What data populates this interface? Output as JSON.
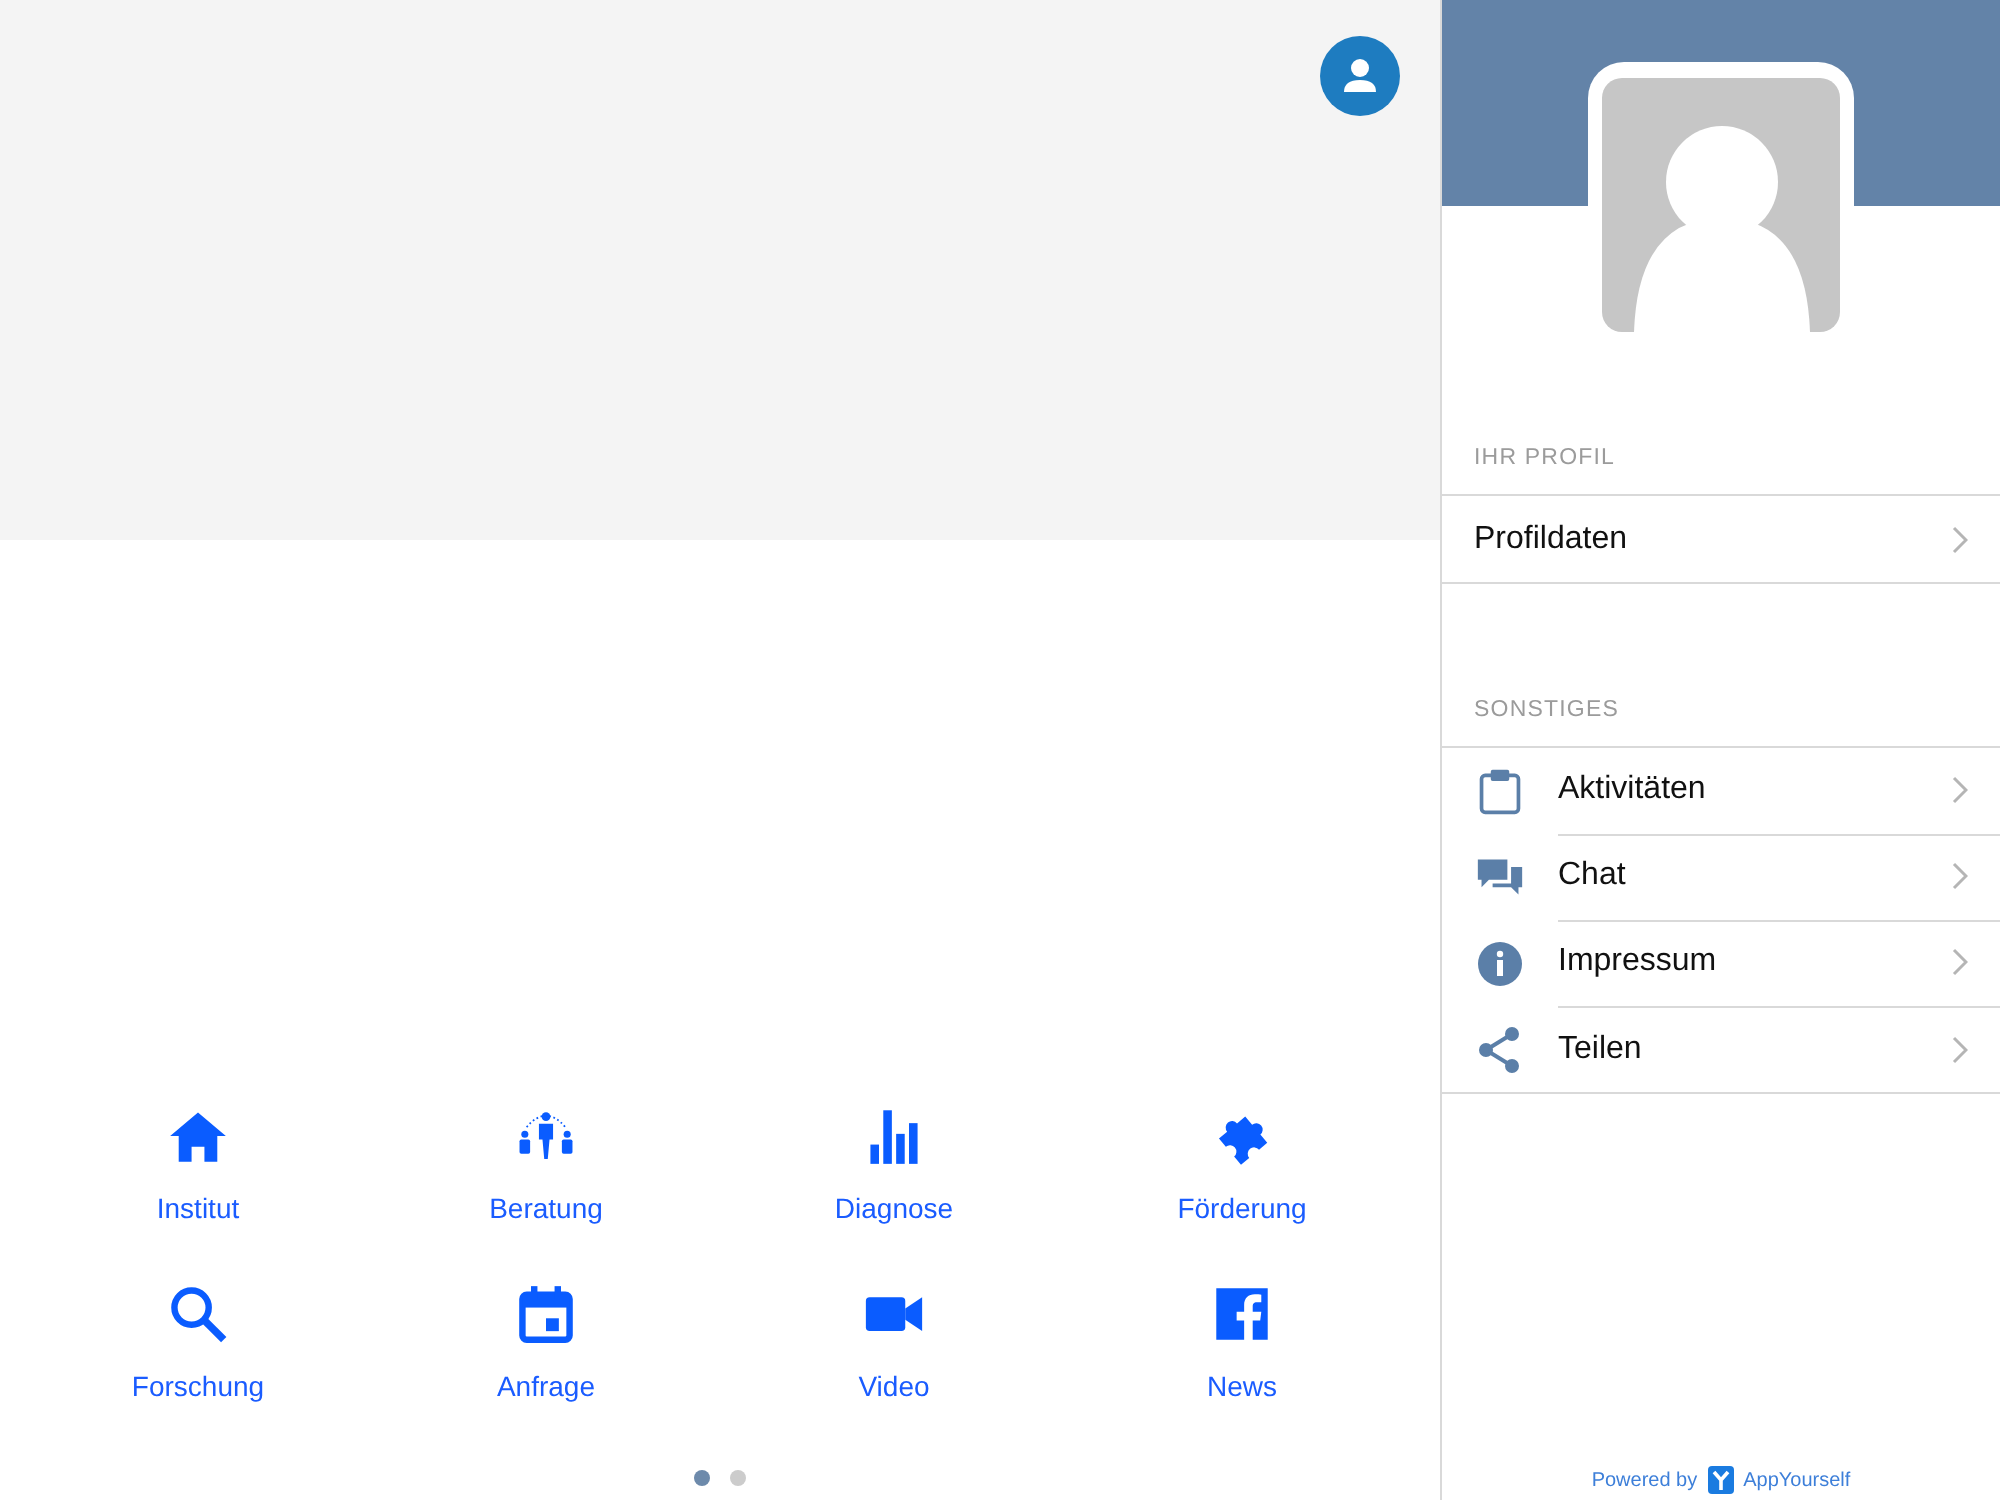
{
  "tiles": [
    {
      "kind": "home",
      "label": "Institut"
    },
    {
      "kind": "people",
      "label": "Beratung"
    },
    {
      "kind": "chart",
      "label": "Diagnose"
    },
    {
      "kind": "puzzle",
      "label": "Förderung"
    },
    {
      "kind": "search",
      "label": "Forschung"
    },
    {
      "kind": "calendar",
      "label": "Anfrage"
    },
    {
      "kind": "video",
      "label": "Video"
    },
    {
      "kind": "facebook",
      "label": "News"
    }
  ],
  "pages": [
    {
      "selected": true
    },
    {
      "selected": false
    }
  ],
  "sidebar": {
    "sections": [
      {
        "title": "IHR PROFIL",
        "items": [
          {
            "label": "Profildaten"
          }
        ]
      },
      {
        "title": "SONSTIGES",
        "items": [
          {
            "kind": "clipboard",
            "label": "Aktivitäten"
          },
          {
            "kind": "chat",
            "label": "Chat"
          },
          {
            "kind": "info",
            "label": "Impressum"
          },
          {
            "kind": "share",
            "label": "Teilen"
          }
        ]
      }
    ],
    "footer": {
      "prefix": "Powered by",
      "brand": "AppYourself"
    }
  }
}
